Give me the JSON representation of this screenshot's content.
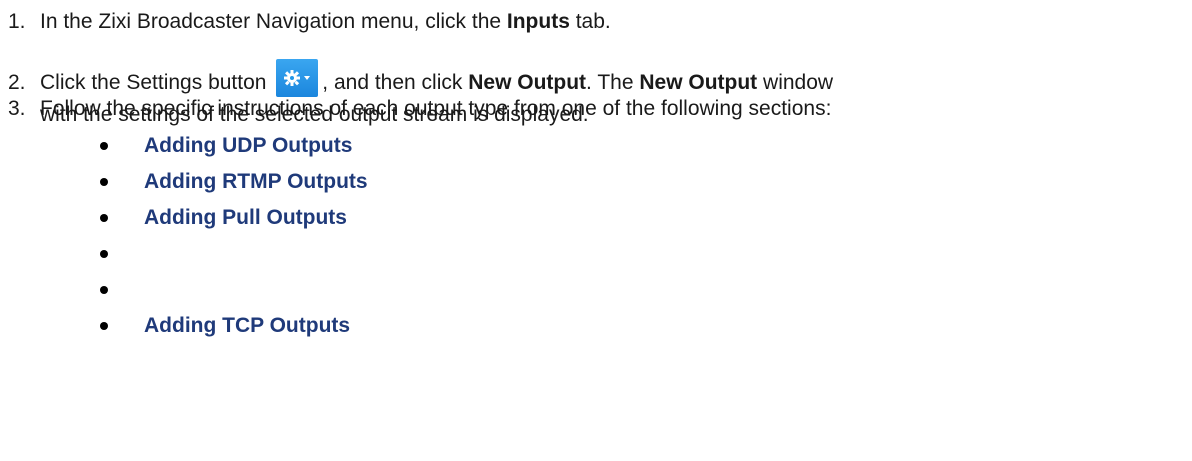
{
  "steps": [
    {
      "number": "1.",
      "pre": "In the Zixi Broadcaster Navigation menu, click the ",
      "bold": "Inputs",
      "post": " tab."
    },
    {
      "number": "2.",
      "pre": "Click the Settings button ",
      "post1": ", and then click ",
      "bold1": "New Output",
      "post2": ". The ",
      "bold2": "New Output",
      "post3": " window",
      "line2": "with the settings of the selected output stream is displayed."
    },
    {
      "number": "3.",
      "text": "Follow the specific instructions of each output type from one of the following sections:"
    }
  ],
  "settings_button": {
    "icon": "gear-icon",
    "caret": "caret-down-icon",
    "color": "#2196e8"
  },
  "sections": [
    "Adding UDP Outputs",
    "Adding RTMP Outputs",
    "Adding Pull Outputs",
    "",
    "",
    "Adding TCP Outputs"
  ]
}
